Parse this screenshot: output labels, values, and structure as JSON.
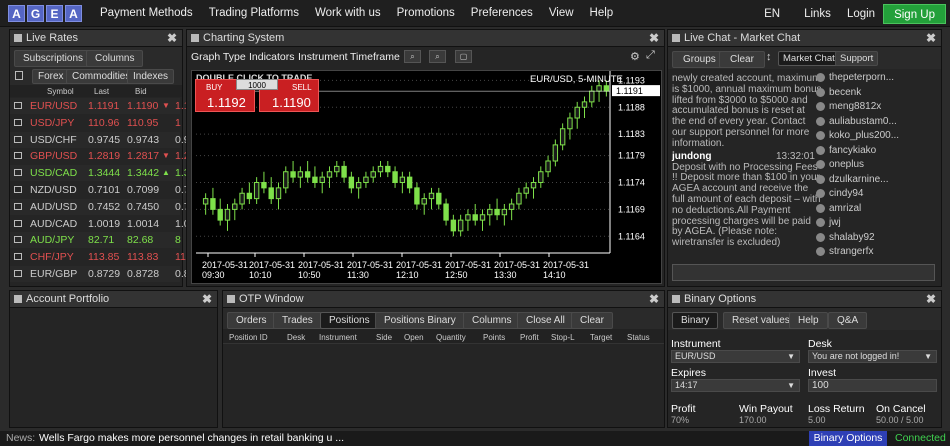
{
  "logo": {
    "letters": [
      "A",
      "G",
      "E",
      "A"
    ]
  },
  "nav": {
    "items": [
      "Payment Methods",
      "Trading Platforms",
      "Work with us",
      "Promotions",
      "Preferences",
      "View",
      "Help"
    ],
    "lang": "EN",
    "links": "Links",
    "login": "Login",
    "signup": "Sign Up"
  },
  "rates": {
    "title": "Live Rates",
    "subscriptions": "Subscriptions",
    "columns": "Columns",
    "tabs": [
      "Forex",
      "Commodities",
      "Indexes"
    ],
    "headers": {
      "symbol": "Symbol",
      "last": "Last",
      "bid": "Bid"
    },
    "rows": [
      {
        "symbol": "EUR/USD",
        "last": "1.1191",
        "bid": "1.1190",
        "ask": "1.1",
        "dir": "down",
        "color": "#e05050"
      },
      {
        "symbol": "USD/JPY",
        "last": "110.96",
        "bid": "110.95",
        "ask": "1",
        "dir": "",
        "color": "#e05050"
      },
      {
        "symbol": "USD/CHF",
        "last": "0.9745",
        "bid": "0.9743",
        "ask": "0.9",
        "dir": "",
        "color": "#ccc"
      },
      {
        "symbol": "GBP/USD",
        "last": "1.2819",
        "bid": "1.2817",
        "ask": "1.2",
        "dir": "down",
        "color": "#e05050"
      },
      {
        "symbol": "USD/CAD",
        "last": "1.3444",
        "bid": "1.3442",
        "ask": "1.3",
        "dir": "up",
        "color": "#7ee04a"
      },
      {
        "symbol": "NZD/USD",
        "last": "0.7101",
        "bid": "0.7099",
        "ask": "0.7",
        "dir": "",
        "color": "#ccc"
      },
      {
        "symbol": "AUD/USD",
        "last": "0.7452",
        "bid": "0.7450",
        "ask": "0.7",
        "dir": "",
        "color": "#ccc"
      },
      {
        "symbol": "AUD/CAD",
        "last": "1.0019",
        "bid": "1.0014",
        "ask": "1.0",
        "dir": "",
        "color": "#ccc"
      },
      {
        "symbol": "AUD/JPY",
        "last": "82.71",
        "bid": "82.68",
        "ask": "8",
        "dir": "",
        "color": "#7ee04a"
      },
      {
        "symbol": "CHF/JPY",
        "last": "113.85",
        "bid": "113.83",
        "ask": "11",
        "dir": "",
        "color": "#e05050"
      },
      {
        "symbol": "EUR/GBP",
        "last": "0.8729",
        "bid": "0.8728",
        "ask": "0.8",
        "dir": "",
        "color": "#ccc"
      }
    ]
  },
  "chart": {
    "title": "Charting System",
    "toolbar": [
      "Graph Type",
      "Indicators",
      "Instrument",
      "Timeframe"
    ],
    "hint": "DOUBLE CLICK TO TRADE",
    "buy": "BUY",
    "sell": "SELL",
    "amount": "1000",
    "buy_price": "1.1192",
    "sell_price": "1.1190",
    "symbol": "EUR/USD, 5-MINUTE",
    "current": "1.1191"
  },
  "chart_data": {
    "type": "candlestick",
    "title": "EUR/USD, 5-MINUTE",
    "x": [
      "2017-05-31 09:30",
      "2017-05-31 10:10",
      "2017-05-31 10:50",
      "2017-05-31 11:30",
      "2017-05-31 12:10",
      "2017-05-31 12:50",
      "2017-05-31 13:30",
      "2017-05-31 14:10"
    ],
    "yticks": [
      "1.1193",
      "1.1188",
      "1.1183",
      "1.1179",
      "1.1174",
      "1.1169",
      "1.1164"
    ],
    "ylim": [
      1.1162,
      1.1194
    ],
    "candles": [
      [
        1.117,
        1.1172,
        1.1168,
        1.1171
      ],
      [
        1.1171,
        1.1173,
        1.1168,
        1.1169
      ],
      [
        1.1169,
        1.1171,
        1.1166,
        1.1167
      ],
      [
        1.1167,
        1.117,
        1.1165,
        1.1169
      ],
      [
        1.1169,
        1.1171,
        1.1167,
        1.117
      ],
      [
        1.117,
        1.1173,
        1.1169,
        1.1172
      ],
      [
        1.1172,
        1.1174,
        1.117,
        1.1171
      ],
      [
        1.1171,
        1.1175,
        1.117,
        1.1174
      ],
      [
        1.1174,
        1.1176,
        1.1172,
        1.1173
      ],
      [
        1.1173,
        1.1175,
        1.117,
        1.1171
      ],
      [
        1.1171,
        1.1174,
        1.1169,
        1.1173
      ],
      [
        1.1173,
        1.1177,
        1.1172,
        1.1176
      ],
      [
        1.1176,
        1.1178,
        1.1174,
        1.1175
      ],
      [
        1.1175,
        1.1177,
        1.1173,
        1.1176
      ],
      [
        1.1176,
        1.1178,
        1.1174,
        1.1175
      ],
      [
        1.1175,
        1.1177,
        1.1173,
        1.1174
      ],
      [
        1.1174,
        1.1176,
        1.1172,
        1.1175
      ],
      [
        1.1175,
        1.1177,
        1.1173,
        1.1176
      ],
      [
        1.1176,
        1.1178,
        1.1175,
        1.1177
      ],
      [
        1.1177,
        1.1178,
        1.1174,
        1.1175
      ],
      [
        1.1175,
        1.1176,
        1.1172,
        1.1173
      ],
      [
        1.1173,
        1.1175,
        1.1171,
        1.1174
      ],
      [
        1.1174,
        1.1176,
        1.1173,
        1.1175
      ],
      [
        1.1175,
        1.1177,
        1.1174,
        1.1176
      ],
      [
        1.1176,
        1.1178,
        1.1175,
        1.1177
      ],
      [
        1.1177,
        1.1178,
        1.1175,
        1.1176
      ],
      [
        1.1176,
        1.1177,
        1.1173,
        1.1174
      ],
      [
        1.1174,
        1.1176,
        1.1172,
        1.1175
      ],
      [
        1.1175,
        1.1176,
        1.1172,
        1.1173
      ],
      [
        1.1173,
        1.1174,
        1.1169,
        1.117
      ],
      [
        1.117,
        1.1172,
        1.1168,
        1.1171
      ],
      [
        1.1171,
        1.1173,
        1.1169,
        1.1172
      ],
      [
        1.1172,
        1.1173,
        1.1169,
        1.117
      ],
      [
        1.117,
        1.1171,
        1.1166,
        1.1167
      ],
      [
        1.1167,
        1.1168,
        1.1164,
        1.1165
      ],
      [
        1.1165,
        1.1168,
        1.1164,
        1.1167
      ],
      [
        1.1167,
        1.1169,
        1.1165,
        1.1168
      ],
      [
        1.1168,
        1.117,
        1.1166,
        1.1167
      ],
      [
        1.1167,
        1.1169,
        1.1165,
        1.1168
      ],
      [
        1.1168,
        1.117,
        1.1166,
        1.1169
      ],
      [
        1.1169,
        1.1171,
        1.1167,
        1.1168
      ],
      [
        1.1168,
        1.117,
        1.1166,
        1.1169
      ],
      [
        1.1169,
        1.1171,
        1.1167,
        1.117
      ],
      [
        1.117,
        1.1173,
        1.1169,
        1.1172
      ],
      [
        1.1172,
        1.1174,
        1.1171,
        1.1173
      ],
      [
        1.1173,
        1.1175,
        1.1171,
        1.1174
      ],
      [
        1.1174,
        1.1177,
        1.1173,
        1.1176
      ],
      [
        1.1176,
        1.1179,
        1.1175,
        1.1178
      ],
      [
        1.1178,
        1.1182,
        1.1177,
        1.1181
      ],
      [
        1.1181,
        1.1185,
        1.118,
        1.1184
      ],
      [
        1.1184,
        1.1187,
        1.1182,
        1.1186
      ],
      [
        1.1186,
        1.1189,
        1.1184,
        1.1188
      ],
      [
        1.1188,
        1.119,
        1.1186,
        1.1189
      ],
      [
        1.1189,
        1.1192,
        1.1188,
        1.1191
      ],
      [
        1.1191,
        1.1193,
        1.1189,
        1.1192
      ],
      [
        1.1192,
        1.1193,
        1.119,
        1.1191
      ]
    ]
  },
  "chat": {
    "title": "Live Chat - Market Chat",
    "groups": "Groups",
    "clear": "Clear",
    "tabs": [
      "Market Chat",
      "Support"
    ],
    "message1": [
      "newly created account, maximum",
      "is $1000, annual maximum bonus",
      "lifted from $3000 to $5000 and",
      "accumulated bonus is reset at",
      "the end of every year. Contact",
      "our support personnel for more",
      "information."
    ],
    "author": "jundong",
    "time": "13:32:01",
    "message2": [
      "Deposit with no Processing Fees",
      "!! Deposit more than $100 in your",
      "AGEA account and receive the",
      "full amount of each deposit – with",
      "no deductions.All Payment",
      "processing charges will be paid",
      "by AGEA. (Please note:",
      "wiretransfer is excluded)"
    ],
    "users": [
      "thepeterporn...",
      "becenk",
      "meng8812x",
      "auliabustam0...",
      "koko_plus200...",
      "fancykiako",
      "oneplus",
      "dzulkarnine...",
      "cindy94",
      "amrizal",
      "jwj",
      "shalaby92",
      "strangerfx"
    ]
  },
  "portfolio": {
    "title": "Account Portfolio"
  },
  "otp": {
    "title": "OTP Window",
    "tabs": [
      "Orders",
      "Trades",
      "Positions",
      "Positions Binary",
      "Columns",
      "Close All",
      "Clear"
    ],
    "columns": [
      "Position ID",
      "Desk",
      "Instrument",
      "Side",
      "Open",
      "Quantity",
      "Points",
      "Profit",
      "Stop-L",
      "Target",
      "Status"
    ]
  },
  "binary": {
    "title": "Binary Options",
    "tabs": [
      "Binary",
      "Reset values",
      "Help",
      "Q&A"
    ],
    "instrument_label": "Instrument",
    "instrument": "EUR/USD",
    "desk_label": "Desk",
    "desk": "You are not logged in!",
    "expires_label": "Expires",
    "expires": "14:17",
    "invest_label": "Invest",
    "invest": "100",
    "profit_label": "Profit",
    "profit": "70%",
    "win_label": "Win Payout",
    "win": "170.00",
    "loss_label": "Loss Return",
    "loss": "5.00",
    "cancel_label": "On Cancel",
    "cancel": "50.00 / 5.00"
  },
  "news": {
    "label": "News:",
    "text": "Wells Fargo makes more personnel changes in retail banking u ...",
    "binary_btn": "Binary Options",
    "status": "Connected"
  }
}
